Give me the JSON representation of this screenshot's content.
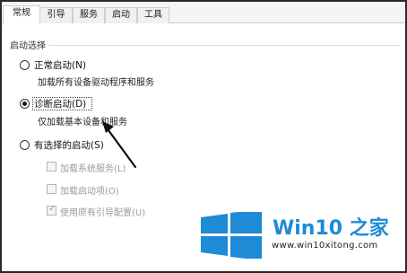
{
  "tabs": [
    {
      "label": "常规",
      "active": true
    },
    {
      "label": "引导",
      "active": false
    },
    {
      "label": "服务",
      "active": false
    },
    {
      "label": "启动",
      "active": false
    },
    {
      "label": "工具",
      "active": false
    }
  ],
  "startup_group": {
    "title": "启动选择",
    "options": [
      {
        "label": "正常启动(N)",
        "description": "加载所有设备驱动程序和服务",
        "selected": false
      },
      {
        "label": "诊断启动(D)",
        "description": "仅加载基本设备和服务",
        "selected": true
      },
      {
        "label": "有选择的启动(S)",
        "selected": false
      }
    ],
    "selective_items": [
      {
        "label": "加载系统服务(L)",
        "checked": false
      },
      {
        "label": "加载启动项(O)",
        "checked": false
      },
      {
        "label": "使用原有引导配置(U)",
        "checked": true
      }
    ]
  },
  "watermark": {
    "brand_text": "Win10 之家",
    "url": "www.win10xitong.com",
    "logo_color": "#1d8bd6"
  }
}
